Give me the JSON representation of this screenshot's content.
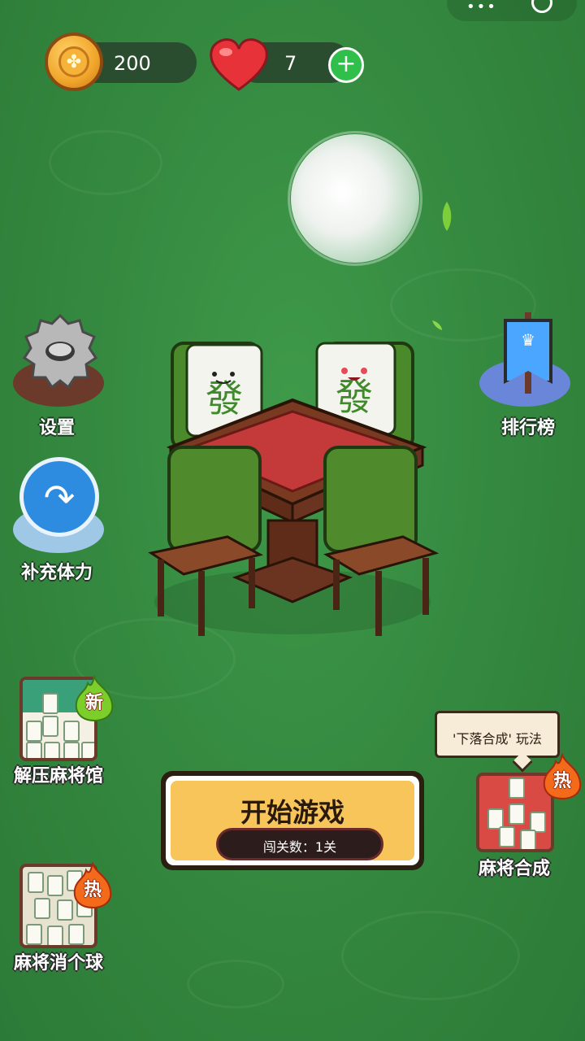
{
  "resources": {
    "coins": "200",
    "lives": "7",
    "add_label": "+"
  },
  "side_buttons": {
    "settings_label": "设置",
    "stamina_label": "补充体力",
    "ranking_label": "排行榜"
  },
  "modes": {
    "relax_hall": {
      "label": "解压麻将馆",
      "badge": "新"
    },
    "mahjong_merge": {
      "label": "麻将合成",
      "badge": "热",
      "tooltip": "'下落合成' 玩法"
    },
    "mahjong_ball": {
      "label": "麻将消个球",
      "badge": "热"
    }
  },
  "start": {
    "title": "开始游戏",
    "level_text": "闯关数：1关"
  },
  "icons": {
    "coin": "coin-icon",
    "heart": "heart-icon",
    "gear": "gear-icon",
    "arrow": "redo-arrow-icon",
    "banner": "banner-icon"
  },
  "colors": {
    "background": "#358a40",
    "start_button": "#f7c55a",
    "plus_green": "#2fbf4a",
    "heart_red": "#e8323a"
  }
}
